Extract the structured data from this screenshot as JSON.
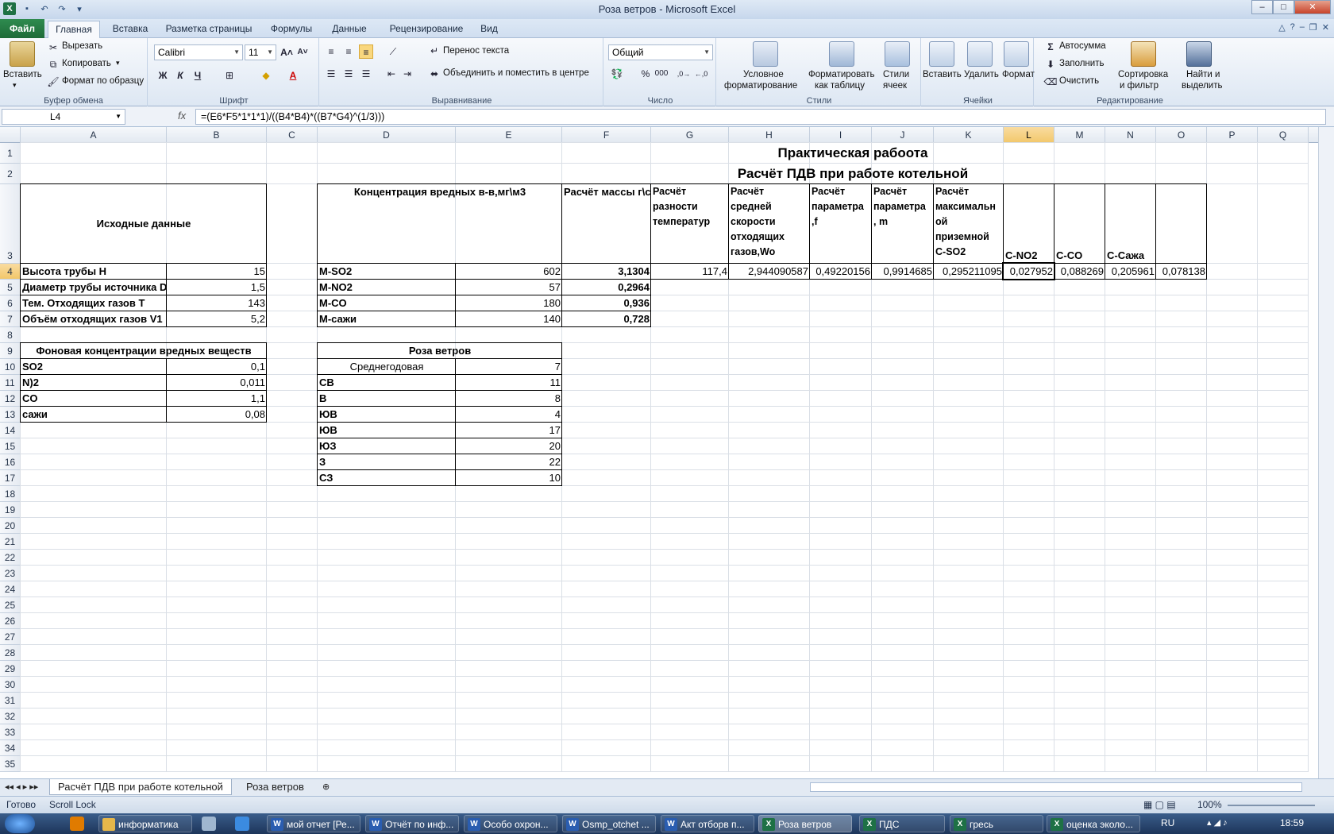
{
  "window": {
    "title": "Роза ветров  -  Microsoft Excel"
  },
  "ribbon_tabs": [
    "Файл",
    "Главная",
    "Вставка",
    "Разметка страницы",
    "Формулы",
    "Данные",
    "Рецензирование",
    "Вид"
  ],
  "ribbon": {
    "clipboard": {
      "paste": "Вставить",
      "cut": "Вырезать",
      "copy": "Копировать",
      "format_painter": "Формат по образцу",
      "label": "Буфер обмена"
    },
    "font": {
      "name": "Calibri",
      "size": "11",
      "label": "Шрифт"
    },
    "alignment": {
      "wrap": "Перенос текста",
      "merge": "Объединить и поместить в центре",
      "label": "Выравнивание"
    },
    "number": {
      "format": "Общий",
      "label": "Число"
    },
    "styles": {
      "cond1": "Условное",
      "cond2": "форматирование",
      "table1": "Форматировать",
      "table2": "как таблицу",
      "cell1": "Стили",
      "cell2": "ячеек",
      "label": "Стили"
    },
    "cells": {
      "insert": "Вставить",
      "delete": "Удалить",
      "format": "Формат",
      "label": "Ячейки"
    },
    "editing": {
      "autosum": "Автосумма",
      "fill": "Заполнить",
      "clear": "Очистить",
      "sort1": "Сортировка",
      "sort2": "и фильтр",
      "find1": "Найти и",
      "find2": "выделить",
      "label": "Редактирование"
    }
  },
  "formula_bar": {
    "name_box": "L4",
    "fx": "fx",
    "formula": "=(E6*F5*1*1*1)/((B4*B4)*((B7*G4)^(1/3)))"
  },
  "columns": [
    "A",
    "B",
    "C",
    "D",
    "E",
    "F",
    "G",
    "H",
    "I",
    "J",
    "K",
    "L",
    "M",
    "N",
    "O",
    "P",
    "Q"
  ],
  "rows": [
    "1",
    "2",
    "3",
    "4",
    "5",
    "6",
    "7",
    "8",
    "9",
    "10",
    "11",
    "12",
    "13",
    "14",
    "15",
    "16",
    "17",
    "18",
    "19",
    "20",
    "21",
    "22",
    "23",
    "24",
    "25",
    "26",
    "27",
    "28",
    "29",
    "30",
    "31",
    "32",
    "33",
    "34",
    "35"
  ],
  "cells": {
    "title1": "Практическая рабоота",
    "title2": "Расчёт ПДВ при работе котельной",
    "src_header": "Исходные данные",
    "a4": "Высота трубы H",
    "b4": "15",
    "a5": "Диаметр трубы источника D",
    "b5": "1,5",
    "a6": "Тем. Отходящих газов T",
    "b6": "143",
    "a7": "Объём отходящих газов V1",
    "b7": "5,2",
    "bg_header": "Фоновая концентрации вредных веществ",
    "a10": "SO2",
    "b10": "0,1",
    "a11": "N)2",
    "b11": "0,011",
    "a12": "CO",
    "b12": "1,1",
    "a13": "сажи",
    "b13": "0,08",
    "conc_header": "Концентрация вредных в-в,мг\\м3",
    "mass_header": "Расчёт массы г\\с",
    "g3": [
      "Расчёт",
      "разности",
      "температур"
    ],
    "h3": [
      "Расчёт",
      "средней",
      "скорости",
      "отходящих",
      "газов,Wo"
    ],
    "i3": [
      "Расчёт",
      "параметра",
      ",f"
    ],
    "j3": [
      "Расчёт",
      "параметра",
      ", m"
    ],
    "k3": [
      "Расчёт",
      "максимальн",
      "ой",
      "приземной",
      "C-SO2"
    ],
    "l3": "C-NO2",
    "m3": "C-CO",
    "n3": "C-Сажа",
    "d4": "M-SO2",
    "e4": "602",
    "f4": "3,1304",
    "g4": "117,4",
    "h4": "2,944090587",
    "i4": "0,49220156",
    "j4": "0,9914685",
    "k4": "0,295211095",
    "l4": "0,027952",
    "m4": "0,088269",
    "n4": "0,205961",
    "o4": "0,078138",
    "d5": "M-NO2",
    "e5": "57",
    "f5": "0,2964",
    "d6": "M-CO",
    "e6": "180",
    "f6": "0,936",
    "d7": "M-сажи",
    "e7": "140",
    "f7": "0,728",
    "wind_header": "Роза ветров",
    "d10": "Среднегодовая",
    "e10": "7",
    "d11": "СВ",
    "e11": "11",
    "d12": "В",
    "e12": "8",
    "d13": "ЮВ",
    "e13": "4",
    "d14": "ЮВ",
    "e14": "17",
    "d15": "ЮЗ",
    "e15": "20",
    "d16": "З",
    "e16": "22",
    "d17": "СЗ",
    "e17": "10"
  },
  "sheet_tabs": [
    "Расчёт ПДВ при работе котельной",
    "Роза ветров"
  ],
  "status": {
    "ready": "Готово",
    "scroll_lock": "Scroll Lock",
    "zoom": "100%"
  },
  "taskbar": {
    "items": [
      "информатика",
      "мой отчет [Ре...",
      "Отчёт по инф...",
      "Особо охрон...",
      "Osmp_otchet ...",
      "Акт отборв п...",
      "Роза ветров",
      "ПДС",
      "гресь",
      "оценка эколо..."
    ],
    "lang": "RU",
    "time": "18:59"
  }
}
